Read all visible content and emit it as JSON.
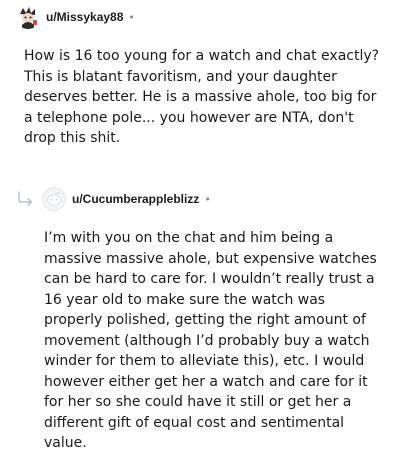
{
  "comments": [
    {
      "username": "u/Missykay88",
      "separator": "•",
      "avatar_icon": "snoo-avatar-icon",
      "body": "How is 16 too young for a watch and chat exactly? This is blatant favoritism, and your daughter deserves better. He is a massive ahole, too big for a telephone pole... you however are NTA, don't drop this shit."
    },
    {
      "username": "u/Cucumberappleblizz",
      "separator": "•",
      "avatar_icon": "default-avatar-icon",
      "reply_icon": "reply-arrow-icon",
      "body": "I’m with you on the chat and him being a massive massive ahole, but expensive watches can be hard to care for. I wouldn’t really trust a 16 year old to make sure the watch was properly polished, getting the right amount of movement (although I’d probably buy a watch winder for them to alleviate this), etc. I would however either get her a watch and care for it for her so she could have it still or get her a different gift of equal cost and sentimental value."
    }
  ],
  "colors": {
    "text": "#1a1a1b",
    "meta": "#878a8c",
    "reply_arrow": "#bcc4cc"
  }
}
